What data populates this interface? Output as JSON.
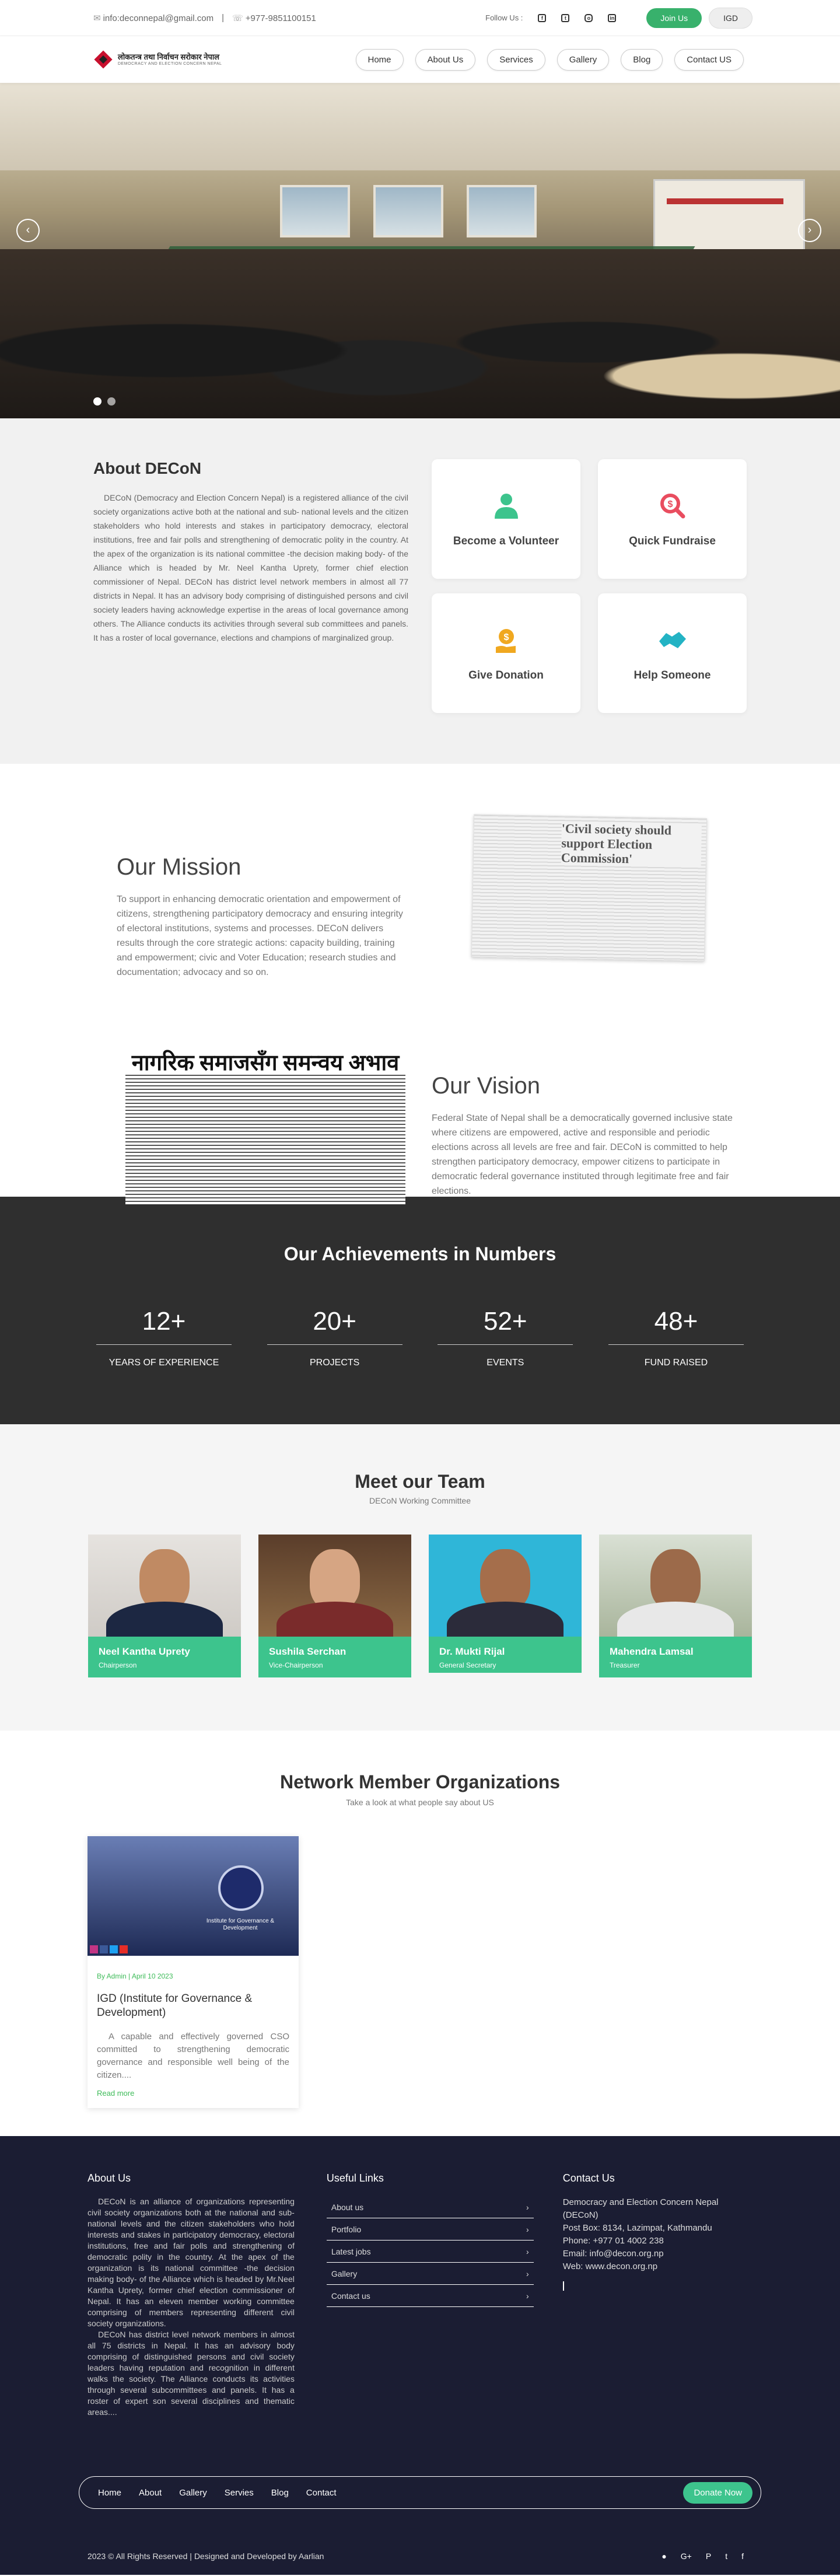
{
  "topbar": {
    "email": "info:deconnepal@gmail.com",
    "separator": "|",
    "phone": "+977-9851100151",
    "follow_label": "Follow Us :",
    "join_label": "Join Us",
    "igd_label": "IGD"
  },
  "nav": {
    "logo_text": "लोकतन्त्र तथा निर्वाचन सरोकार नेपाल",
    "logo_sub": "DEMOCRACY AND ELECTION CONCERN NEPAL",
    "items": [
      "Home",
      "About Us",
      "Services",
      "Gallery",
      "Blog",
      "Contact US"
    ]
  },
  "hero": {
    "prev": "‹",
    "next": "›",
    "slides": 2,
    "active": 0
  },
  "about": {
    "title": "About DECoN",
    "body": "DECoN (Democracy and Election Concern Nepal) is a registered alliance of the civil society organizations active both at the national and sub- national levels and the citizen stakeholders who hold interests and stakes in participatory democracy, electoral institutions, free and fair polls and strengthening of democratic polity in the country. At the apex of the organization is its national committee -the decision making body- of the Alliance which is headed by Mr. Neel Kantha Uprety, former chief election commissioner of Nepal. DECoN has district level network members in almost all 77 districts in Nepal. It has an advisory body comprising of distinguished persons and civil society leaders having acknowledge expertise in the areas of local governance among others. The Alliance conducts its activities through several sub committees and panels. It has a roster of local governance, elections and champions of marginalized group.",
    "cards": [
      {
        "label": "Become a Volunteer",
        "icon": "user-icon",
        "color": "#3dc48d"
      },
      {
        "label": "Quick Fundraise",
        "icon": "search-money-icon",
        "color": "#e94d5f"
      },
      {
        "label": "Give Donation",
        "icon": "donation-icon",
        "color": "#f0a81f"
      },
      {
        "label": "Help Someone",
        "icon": "handshake-icon",
        "color": "#23b3c4"
      }
    ]
  },
  "mission": {
    "title": "Our Mission",
    "body": "To support in enhancing democratic orientation and empowerment of citizens, strengthening participatory democracy and ensuring integrity of electoral institutions, systems and processes. DECoN delivers results through the core strategic actions: capacity building, training and empowerment; civic and Voter Education; research studies and documentation; advocacy and so on.",
    "clipping_headline": "'Civil society should support Election Commission'"
  },
  "vision": {
    "title": "Our Vision",
    "body": "Federal State of Nepal shall be a democratically governed inclusive state where citizens are empowered, active and responsible and periodic elections across all levels are free and fair. DECoN is committed to help strengthen participatory democracy, empower citizens to participate in democratic federal governance instituted through legitimate free and fair elections.",
    "clipping_headline": "नागरिक समाजसँग समन्वय अभाव"
  },
  "achievements": {
    "title": "Our Achievements in Numbers",
    "stats": [
      {
        "num": "12+",
        "label": "YEARS OF EXPERIENCE"
      },
      {
        "num": "20+",
        "label": "PROJECTS"
      },
      {
        "num": "52+",
        "label": "EVENTS"
      },
      {
        "num": "48+",
        "label": "FUND RAISED"
      }
    ]
  },
  "team": {
    "title": "Meet our Team",
    "subtitle": "DECoN Working Committee",
    "members": [
      {
        "name": "Neel Kantha Uprety",
        "role": "Chairperson"
      },
      {
        "name": "Sushila Serchan",
        "role": "Vice-Chairperson"
      },
      {
        "name": "Dr. Mukti Rijal",
        "role": "General Secretary"
      },
      {
        "name": "Mahendra Lamsal",
        "role": "Treasurer"
      }
    ]
  },
  "network": {
    "title": "Network Member Organizations",
    "subtitle": "Take a look at what people say about US",
    "post": {
      "image_text": "Institute for Governance & Development",
      "meta": "By Admin | April 10 2023",
      "title": "IGD (Institute for Governance & Development)",
      "excerpt": "A capable and effectively governed CSO committed to strengthening democratic governance and responsible well being of the citizen....",
      "more": "Read more"
    }
  },
  "footer": {
    "about_title": "About Us",
    "about_p1": "DECoN is an alliance of organizations representing civil society organizations both at the national and sub-national levels and the citizen stakeholders who hold interests and stakes in participatory democracy, electoral institutions, free and fair polls and strengthening of democratic polity in the country. At the apex of the organization is its national committee -the decision making body- of the Alliance which is headed by Mr.Neel Kantha Uprety, former chief election commissioner of Nepal. It has an eleven member working committee comprising of members representing different civil society organizations.",
    "about_p2": "DECoN has district level network members in almost all 75 districts in Nepal. It has an advisory body comprising of distinguished persons and civil society leaders having reputation and recognition in different walks the society. The Alliance conducts its activities through several subcommittees and panels. It has a roster of expert son several disciplines and thematic areas....",
    "links_title": "Useful Links",
    "links": [
      "About us",
      "Portfolio",
      "Latest jobs",
      "Gallery",
      "Contact us"
    ],
    "contact_title": "Contact Us",
    "contact": {
      "org": "Democracy and Election Concern Nepal (DECoN)",
      "address": "Post Box: 8134, Lazimpat, Kathmandu",
      "phone": "Phone: +977 01 4002 238",
      "email": "Email: info@decon.org.np",
      "web": "Web: www.decon.org.np"
    },
    "nav": [
      "Home",
      "About",
      "Gallery",
      "Servies",
      "Blog",
      "Contact"
    ],
    "donate": "Donate Now",
    "copyright": "2023 © All Rights Reserved | Designed and Developed by Aarlian"
  }
}
